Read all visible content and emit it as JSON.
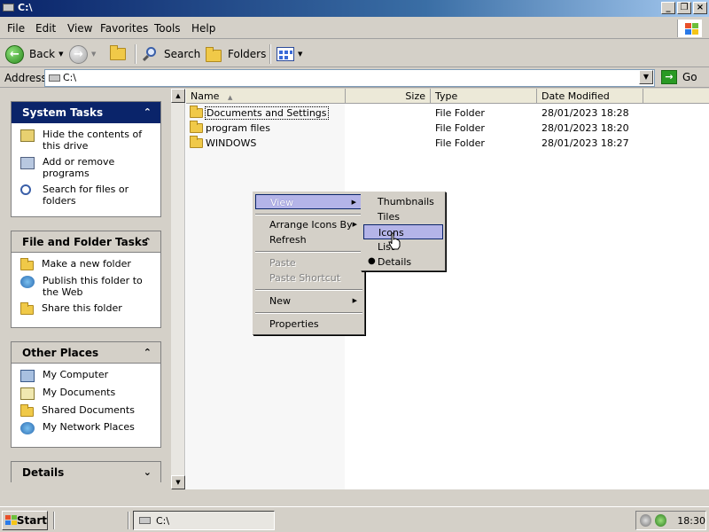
{
  "window": {
    "title": "C:\\"
  },
  "menubar": {
    "items": [
      "File",
      "Edit",
      "View",
      "Favorites",
      "Tools",
      "Help"
    ]
  },
  "toolbar": {
    "back_label": "Back",
    "search_label": "Search",
    "folders_label": "Folders"
  },
  "address": {
    "label": "Address",
    "value": "C:\\",
    "go_label": "Go"
  },
  "taskpane": {
    "system_tasks": {
      "title": "System Tasks",
      "items": [
        "Hide the contents of this drive",
        "Add or remove programs",
        "Search for files or folders"
      ]
    },
    "file_folder_tasks": {
      "title": "File and Folder Tasks",
      "items": [
        "Make a new folder",
        "Publish this folder to the Web",
        "Share this folder"
      ]
    },
    "other_places": {
      "title": "Other Places",
      "items": [
        "My Computer",
        "My Documents",
        "Shared Documents",
        "My Network Places"
      ]
    },
    "details": {
      "title": "Details"
    }
  },
  "columns": {
    "name": "Name",
    "size": "Size",
    "type": "Type",
    "date": "Date Modified"
  },
  "files": [
    {
      "name": "Documents and Settings",
      "type": "File Folder",
      "date": "28/01/2023 18:28"
    },
    {
      "name": "program files",
      "type": "File Folder",
      "date": "28/01/2023 18:20"
    },
    {
      "name": "WINDOWS",
      "type": "File Folder",
      "date": "28/01/2023 18:27"
    }
  ],
  "context_menu": {
    "items": [
      "View",
      "Arrange Icons By",
      "Refresh",
      "Paste",
      "Paste Shortcut",
      "New",
      "Properties"
    ]
  },
  "view_submenu": {
    "items": [
      "Thumbnails",
      "Tiles",
      "Icons",
      "List",
      "Details"
    ],
    "selected": "Details"
  },
  "taskbar": {
    "start_label": "Start",
    "window_item": "C:\\",
    "clock": "18:30"
  }
}
